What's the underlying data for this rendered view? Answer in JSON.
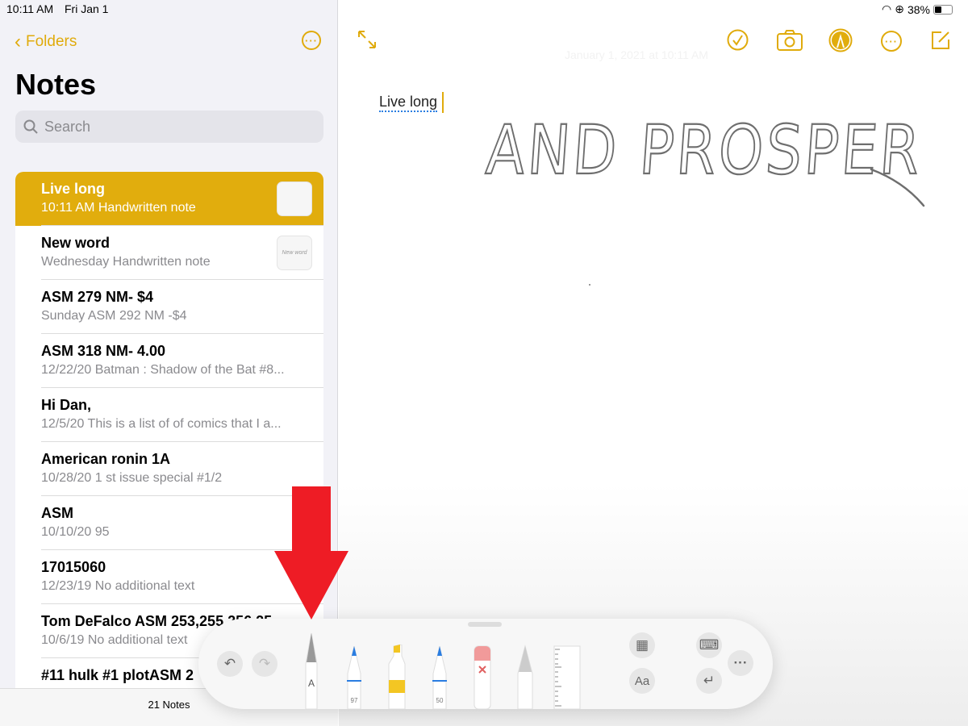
{
  "status": {
    "time": "10:11 AM",
    "date": "Fri Jan 1",
    "battery": "38%"
  },
  "sidebar": {
    "back_label": "Folders",
    "title": "Notes",
    "search_placeholder": "Search",
    "count": "21 Notes",
    "notes": [
      {
        "title": "Live long",
        "subtitle": "10:11 AM  Handwritten note",
        "selected": true,
        "thumb": ""
      },
      {
        "title": "New word",
        "subtitle": "Wednesday  Handwritten note",
        "thumb": "New word"
      },
      {
        "title": "ASM 279 NM- $4",
        "subtitle": "Sunday  ASM 292 NM -$4"
      },
      {
        "title": "ASM 318  NM- 4.00",
        "subtitle": "12/22/20  Batman : Shadow of the Bat #8..."
      },
      {
        "title": "Hi Dan,",
        "subtitle": "12/5/20  This is a list of of comics that I a..."
      },
      {
        "title": "American ronin 1A",
        "subtitle": "10/28/20  1 st issue special #1/2"
      },
      {
        "title": "ASM",
        "subtitle": "10/10/20  95"
      },
      {
        "title": "17015060",
        "subtitle": "12/23/19  No additional text"
      },
      {
        "title": "Tom DeFalco ASM 253,255,256,25",
        "subtitle": "10/6/19  No additional text"
      },
      {
        "title": "#11 hulk #1 plotASM 2",
        "subtitle": ""
      }
    ]
  },
  "note": {
    "date": "January 1, 2021 at 10:11 AM",
    "typed_text": "Live long",
    "handwriting": "AND PROSPER"
  },
  "palette": {
    "pen_label": "A",
    "marker_size": "97",
    "pencil_size": "50",
    "text_style_label": "Aa",
    "colors": {
      "accent": "#e1ad0d",
      "blue": "#2a7de1",
      "yellow": "#f3c623",
      "eraser": "#f19a9a",
      "arrow": "#ee1c25"
    }
  }
}
